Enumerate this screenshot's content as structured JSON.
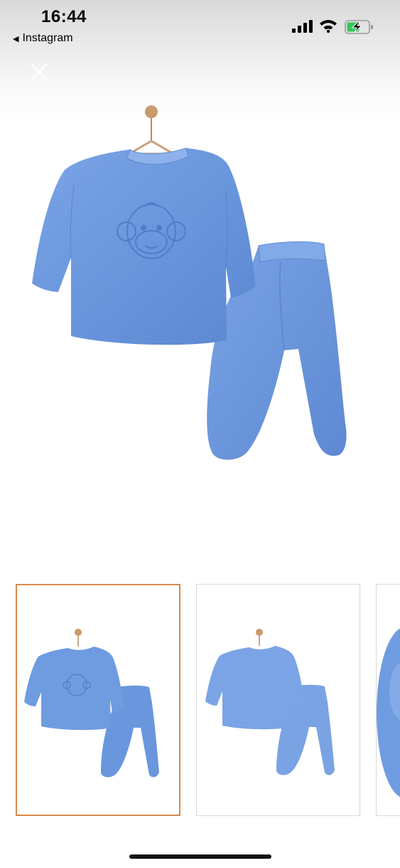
{
  "status_bar": {
    "time": "16:44",
    "back_app": "Instagram",
    "back_glyph": "◀",
    "icons": [
      "signal-icon",
      "wifi-icon",
      "battery-charging-icon"
    ]
  },
  "viewer": {
    "close_icon": "close-icon",
    "main_image": "product-photo-blue-velour-baby-set-with-monkey-embroidery",
    "thumbnails": [
      {
        "image": "front-view",
        "selected": true
      },
      {
        "image": "back-view",
        "selected": false
      },
      {
        "image": "fabric-detail",
        "selected": false
      }
    ]
  },
  "colors": {
    "fabric": "#6f9be0",
    "fabric_dark": "#4c79c8",
    "selected_border": "#d9894a",
    "hanger": "#c99a6b"
  }
}
